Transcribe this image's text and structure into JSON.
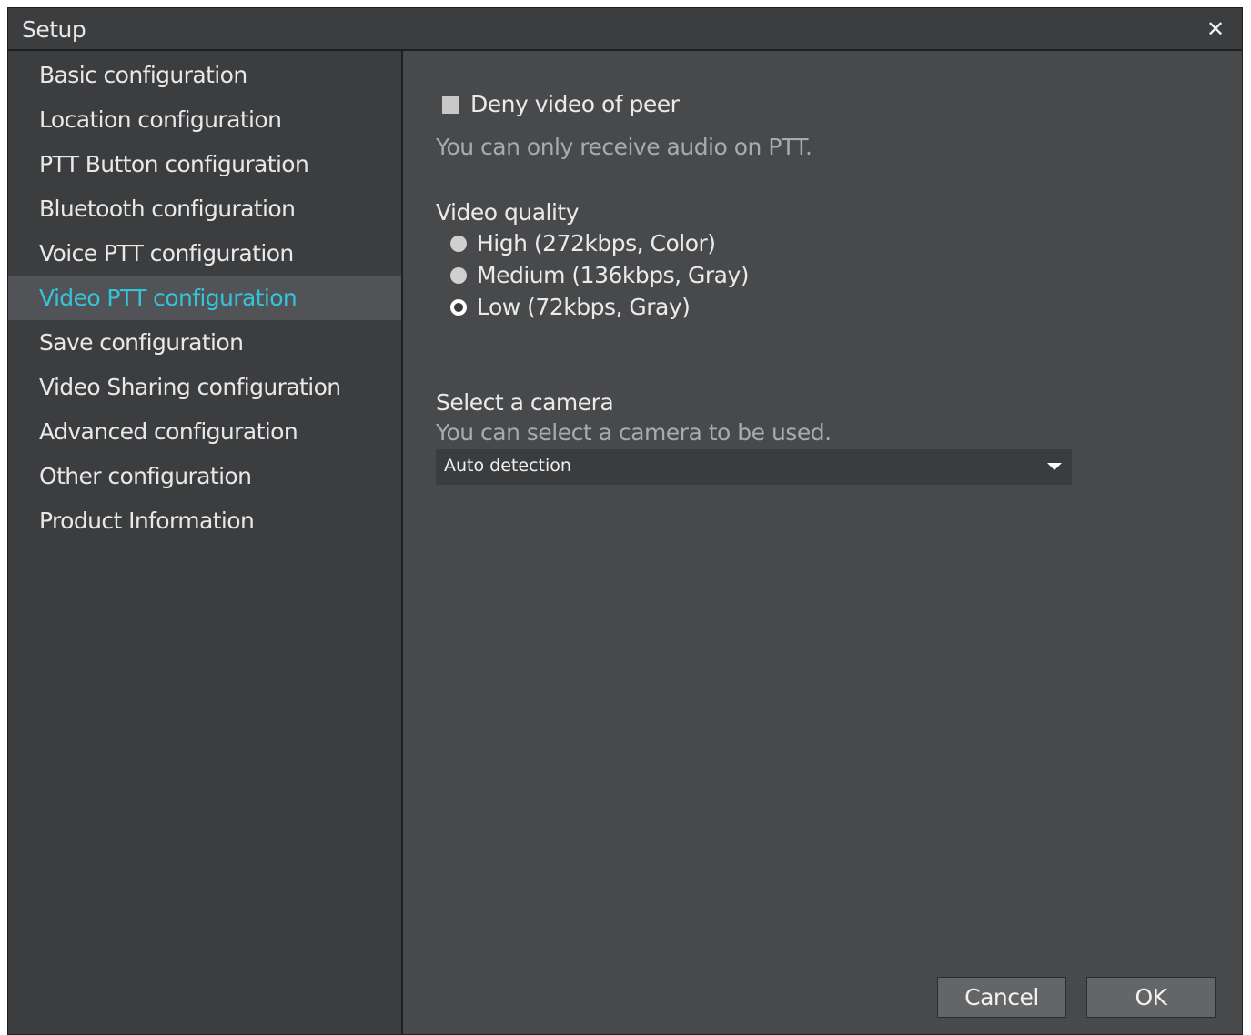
{
  "window": {
    "title": "Setup",
    "close_glyph": "✕"
  },
  "sidebar": {
    "items": [
      {
        "label": "Basic configuration"
      },
      {
        "label": "Location configuration"
      },
      {
        "label": "PTT Button configuration"
      },
      {
        "label": "Bluetooth configuration"
      },
      {
        "label": "Voice PTT configuration"
      },
      {
        "label": "Video PTT configuration",
        "active": true
      },
      {
        "label": "Save configuration"
      },
      {
        "label": "Video Sharing configuration"
      },
      {
        "label": "Advanced configuration"
      },
      {
        "label": "Other configuration"
      },
      {
        "label": "Product Information"
      }
    ]
  },
  "main": {
    "deny_video": {
      "label": "Deny video of peer",
      "checked": false,
      "hint": "You can only receive audio on PTT."
    },
    "video_quality": {
      "label": "Video quality",
      "options": [
        {
          "label": "High (272kbps, Color)",
          "selected": false
        },
        {
          "label": "Medium (136kbps, Gray)",
          "selected": false
        },
        {
          "label": "Low (72kbps, Gray)",
          "selected": true
        }
      ]
    },
    "camera": {
      "label": "Select a camera",
      "hint": "You can select a camera to be used.",
      "selected_value": "Auto detection"
    }
  },
  "footer": {
    "cancel_label": "Cancel",
    "ok_label": "OK"
  },
  "colors": {
    "accent": "#33c4d9",
    "panel_bg": "#48494b",
    "sidebar_bg": "#3c3d3f"
  }
}
